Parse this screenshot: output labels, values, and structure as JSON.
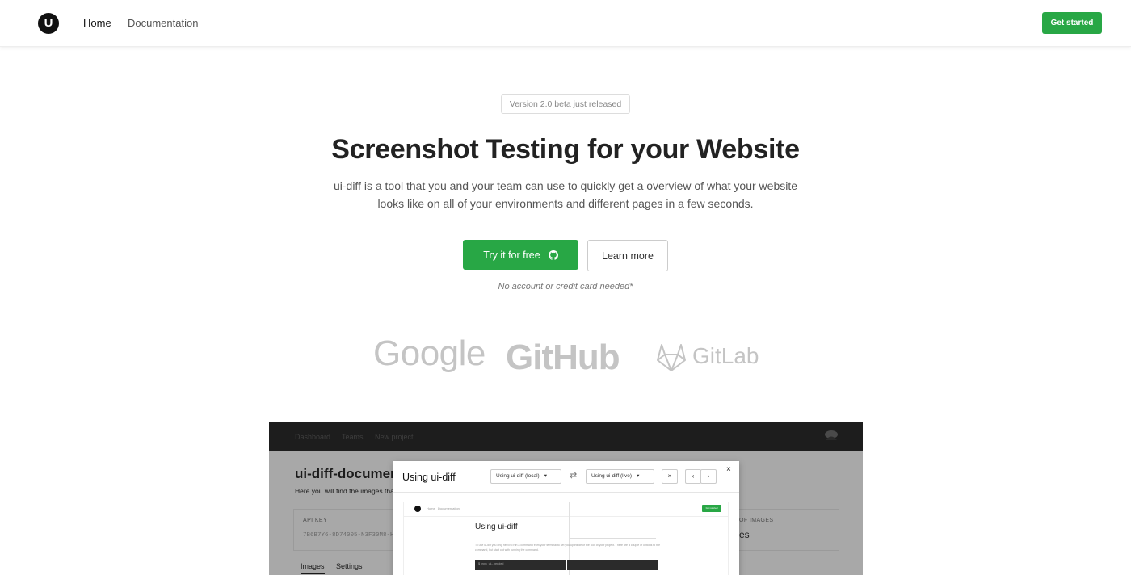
{
  "nav": {
    "logo_letter": "U",
    "links": [
      "Home",
      "Documentation"
    ],
    "cta": "Get started"
  },
  "hero": {
    "badge": "Version 2.0 beta just released",
    "title": "Screenshot Testing for your Website",
    "subtitle_line1": "ui-diff is a tool that you and your team can use to quickly get a overview of what your website",
    "subtitle_line2": "looks like on all of your environments and different pages in a few seconds.",
    "primary_button": "Try it for free",
    "secondary_button": "Learn more",
    "note": "No account or credit card needed*"
  },
  "brands": [
    "Google",
    "GitHub",
    "GitLab"
  ],
  "preview": {
    "nav_links": [
      "Dashboard",
      "Teams",
      "New project"
    ],
    "title": "ui-diff-documen",
    "description": "Here you will find the images tha",
    "api_key_label": "API KEY",
    "api_key_value": "7B6B7Y6-8D74005-N3F30M8-H",
    "images_label": "OF IMAGES",
    "images_value": "es",
    "tabs": [
      "Images",
      "Settings"
    ],
    "modal": {
      "title": "Using ui-diff",
      "select_left": "Using ui-diff (local)",
      "select_right": "Using ui-diff (live)",
      "close": "×",
      "remove": "×",
      "prev": "‹",
      "next": "›"
    },
    "mini": {
      "title": "Using ui-diff",
      "links": [
        "Home",
        "Documentation"
      ],
      "cta": "Get started",
      "text": "To use ui-diff you only need to run a command from your terminal to set you up inside of the root of your project. There are a couple of options to the command, but start out with running the command.",
      "code": "$ npm ui-needed"
    }
  },
  "colors": {
    "accent": "#28a745",
    "dark_nav": "#1d1d1d",
    "overlay": "#a8a8a8"
  },
  "icons": {
    "github": "github-icon",
    "gitlab": "gitlab-icon",
    "avatar": "avatar-icon",
    "swap": "swap-icon",
    "chevron": "chevron-down-icon"
  }
}
